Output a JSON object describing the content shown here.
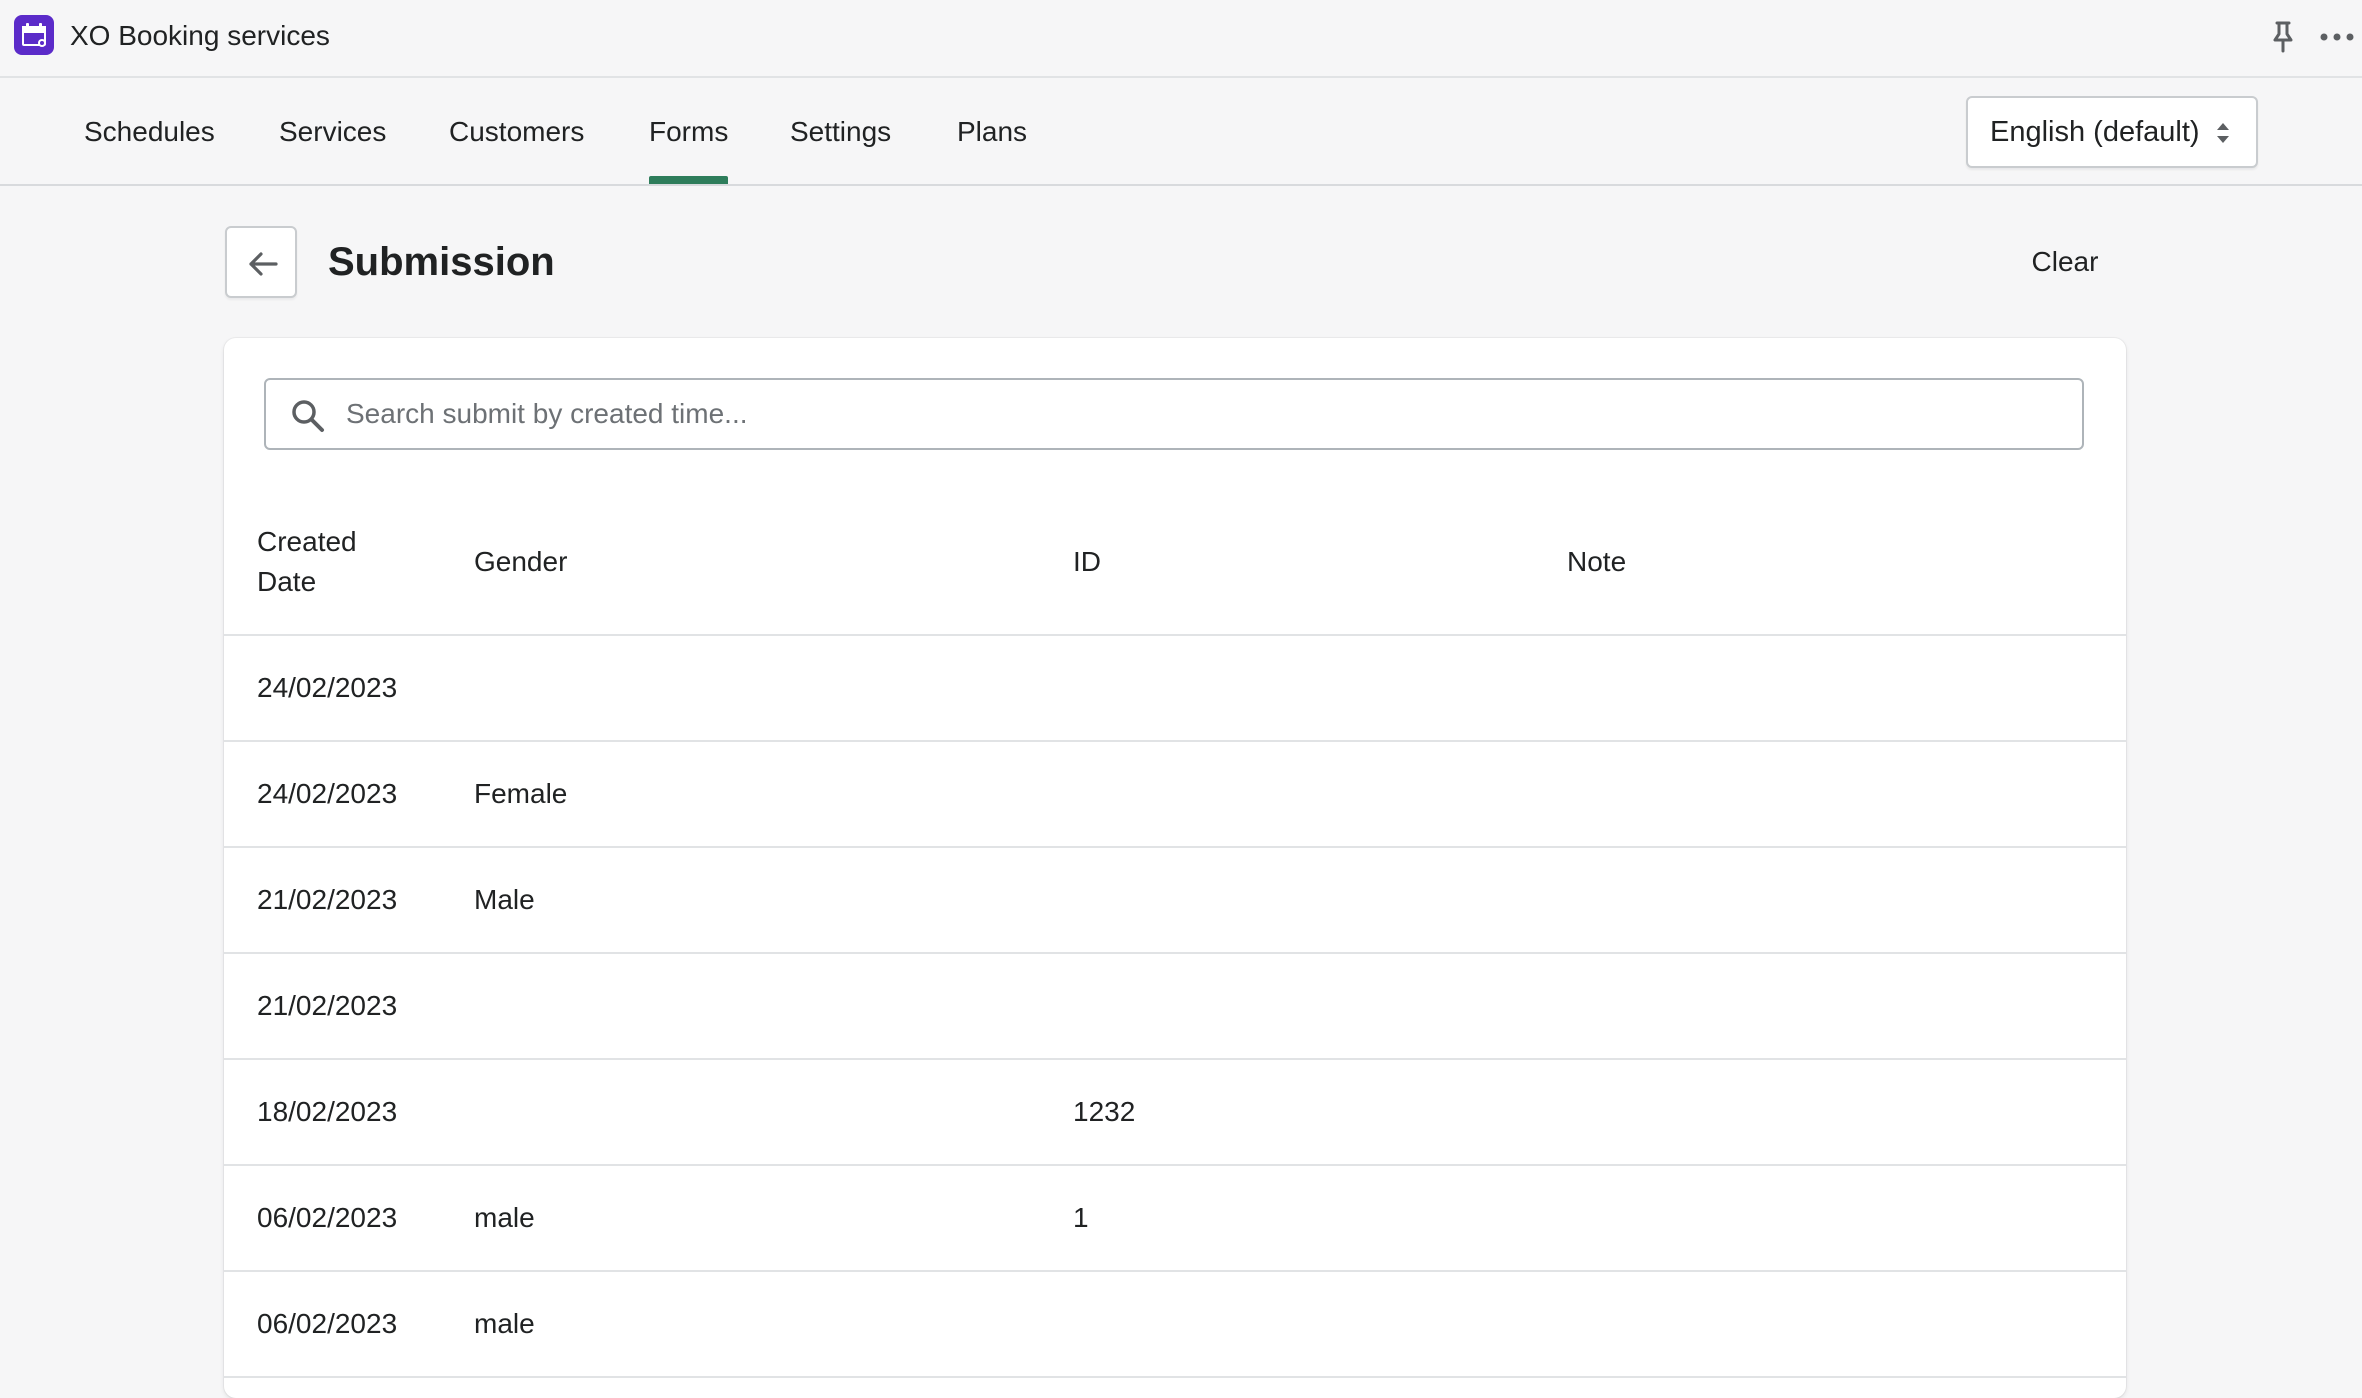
{
  "app": {
    "title": "XO Booking services"
  },
  "nav": {
    "tabs": [
      {
        "label": "Schedules"
      },
      {
        "label": "Services"
      },
      {
        "label": "Customers"
      },
      {
        "label": "Forms",
        "active": true
      },
      {
        "label": "Settings"
      },
      {
        "label": "Plans"
      }
    ],
    "language": {
      "selected": "English (default)"
    }
  },
  "page": {
    "title": "Submission",
    "clear_label": "Clear"
  },
  "search": {
    "placeholder": "Search submit by created time...",
    "value": ""
  },
  "table": {
    "headers": [
      "Created Date",
      "Gender",
      "ID",
      "Note"
    ],
    "rows": [
      [
        "24/02/2023",
        "",
        "",
        ""
      ],
      [
        "24/02/2023",
        "Female",
        "",
        ""
      ],
      [
        "21/02/2023",
        "Male",
        "",
        ""
      ],
      [
        "21/02/2023",
        "",
        "",
        ""
      ],
      [
        "18/02/2023",
        "",
        "1232",
        ""
      ],
      [
        "06/02/2023",
        "male",
        "1",
        ""
      ],
      [
        "06/02/2023",
        "male",
        "",
        ""
      ]
    ]
  },
  "colors": {
    "accent_tab_underline": "#2e7d5b",
    "app_icon": "#5b2bc9",
    "background": "#f6f6f7",
    "card": "#ffffff"
  },
  "icons": {
    "app": "calendar-app-icon",
    "pin": "pin-icon",
    "more": "more-horizontal-icon",
    "language": "select-arrows-icon",
    "back": "arrow-left-icon",
    "search": "search-icon"
  }
}
